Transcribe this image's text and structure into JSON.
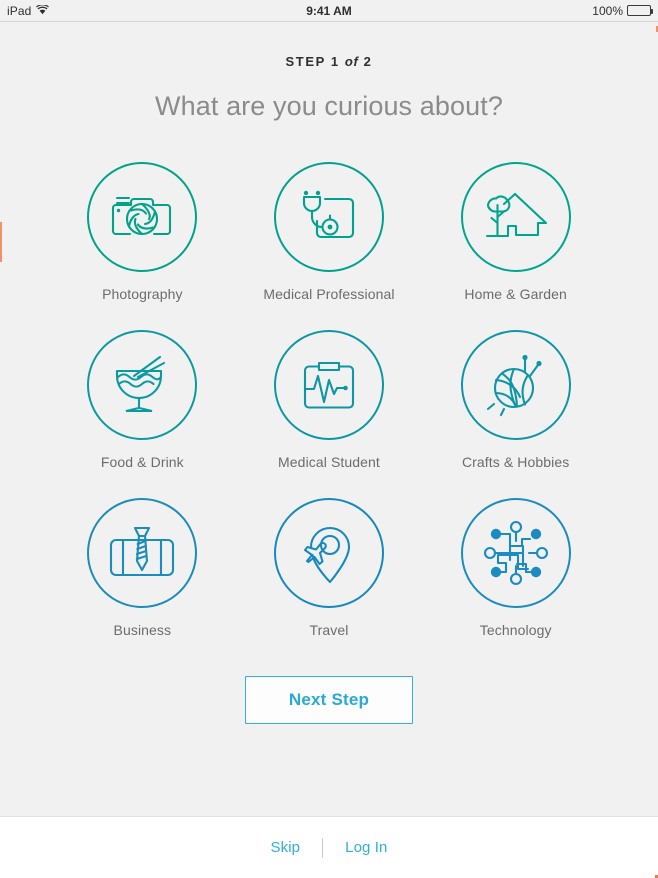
{
  "status_bar": {
    "carrier": "iPad",
    "wifi_icon": "wifi-icon",
    "time": "9:41 AM",
    "battery_percent": "100%",
    "battery_icon": "battery-full-icon"
  },
  "header": {
    "step_prefix": "STEP",
    "step_current": "1",
    "step_of": "of",
    "step_total": "2",
    "headline": "What are you curious about?"
  },
  "interests": [
    {
      "label": "Photography",
      "icon": "camera-icon",
      "color": "#00a388"
    },
    {
      "label": "Medical Professional",
      "icon": "stethoscope-icon",
      "color": "#00a18f"
    },
    {
      "label": "Home & Garden",
      "icon": "house-tree-icon",
      "color": "#00a58e"
    },
    {
      "label": "Food & Drink",
      "icon": "noodle-bowl-icon",
      "color": "#0c9aa2"
    },
    {
      "label": "Medical Student",
      "icon": "clipboard-ekg-icon",
      "color": "#0d97a3"
    },
    {
      "label": "Crafts & Hobbies",
      "icon": "yarn-ball-icon",
      "color": "#0e96a6"
    },
    {
      "label": "Business",
      "icon": "briefcase-tie-icon",
      "color": "#1a8db8"
    },
    {
      "label": "Travel",
      "icon": "map-pin-plane-icon",
      "color": "#1789bd"
    },
    {
      "label": "Technology",
      "icon": "circuit-node-icon",
      "color": "#1a8cc2"
    }
  ],
  "actions": {
    "next_step": "Next Step"
  },
  "footer": {
    "skip": "Skip",
    "divider": "|",
    "log_in": "Log In"
  },
  "colors": {
    "background": "#f1f1f1",
    "accent_blue": "#2aa8d8",
    "link_blue": "#2cb0e0",
    "label_gray": "#6c6c6c",
    "headline_gray": "#8b8b8b",
    "edge_marker": "#f0936b"
  }
}
